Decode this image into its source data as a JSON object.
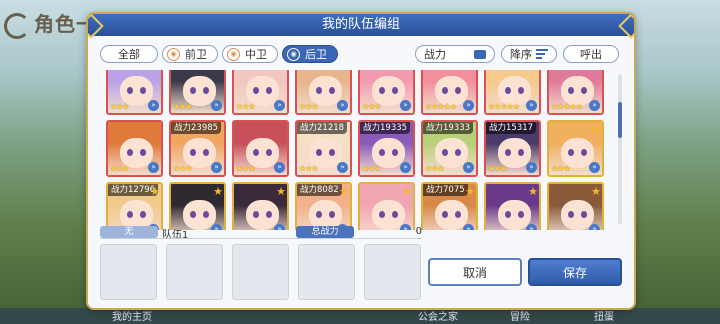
{
  "background": {
    "title": "角色一",
    "bottom_nav": [
      "我的主页",
      "公会之家",
      "冒险",
      "扭蛋"
    ]
  },
  "modal": {
    "title": "我的队伍编组"
  },
  "filters": {
    "tabs": [
      {
        "label": "全部",
        "selected": false
      },
      {
        "label": "前卫",
        "selected": false
      },
      {
        "label": "中卫",
        "selected": false
      },
      {
        "label": "后卫",
        "selected": true
      }
    ],
    "sort_key_label": "战力",
    "order_label": "降序",
    "summon_label": "呼出"
  },
  "roster": {
    "rows": [
      [
        {
          "power": "",
          "stars": "★★★",
          "hair": "#b9a2e6",
          "border": "red"
        },
        {
          "power": "",
          "stars": "★★★",
          "hair": "#3a3a4a",
          "border": "red"
        },
        {
          "power": "",
          "stars": "★★★",
          "hair": "#f2c7c1",
          "border": "red"
        },
        {
          "power": "",
          "stars": "★★★",
          "hair": "#e7b48b",
          "border": "red"
        },
        {
          "power": "",
          "stars": "★★★",
          "hair": "#f39ab0",
          "border": "red"
        },
        {
          "power": "",
          "stars": "★★★★★",
          "hair": "#f28f9d",
          "border": "red"
        },
        {
          "power": "",
          "stars": "★★★★★",
          "hair": "#f6c98c",
          "border": "red"
        },
        {
          "power": "",
          "stars": "★★★★★",
          "hair": "#e07a9a",
          "border": "red"
        }
      ],
      [
        {
          "power": "",
          "stars": "★★★",
          "hair": "#e07a3a",
          "border": "red"
        },
        {
          "power": "战力23985",
          "stars": "★★★",
          "hair": "#f0a560",
          "border": "red"
        },
        {
          "power": "",
          "stars": "★★★",
          "hair": "#c8505a",
          "border": "red"
        },
        {
          "power": "战力21218",
          "stars": "★★★",
          "hair": "#f3e0c5",
          "border": "red"
        },
        {
          "power": "战力19335",
          "stars": "★★★",
          "hair": "#8a5ab8",
          "border": "red"
        },
        {
          "power": "战力19333",
          "stars": "★★★",
          "hair": "#b8d07a",
          "border": "red"
        },
        {
          "power": "战力15317",
          "stars": "★★★",
          "hair": "#4a3a6a",
          "border": "red"
        },
        {
          "power": "",
          "stars": "★★★",
          "hair": "#f0b060",
          "border": "gold"
        }
      ],
      [
        {
          "power": "战力12796",
          "stars": "",
          "hair": "#f1c98a",
          "border": "gold"
        },
        {
          "power": "",
          "stars": "",
          "hair": "#2f2a30",
          "border": "gold"
        },
        {
          "power": "",
          "stars": "",
          "hair": "#3a2a3a",
          "border": "gold"
        },
        {
          "power": "战力8082",
          "stars": "",
          "hair": "#f2b18a",
          "border": "gold"
        },
        {
          "power": "",
          "stars": "",
          "hair": "#f2a6b4",
          "border": "gold"
        },
        {
          "power": "战力7075",
          "stars": "",
          "hair": "#d8894a",
          "border": "gold"
        },
        {
          "power": "",
          "stars": "",
          "hair": "#6a3a8a",
          "border": "gold"
        },
        {
          "power": "",
          "stars": "",
          "hair": "#8a5a3a",
          "border": "gold"
        }
      ]
    ]
  },
  "team": {
    "tag_label": "无",
    "name": "队伍1",
    "total_power_label": "总战力",
    "total_power_value": "0"
  },
  "actions": {
    "cancel_label": "取消",
    "save_label": "保存"
  }
}
